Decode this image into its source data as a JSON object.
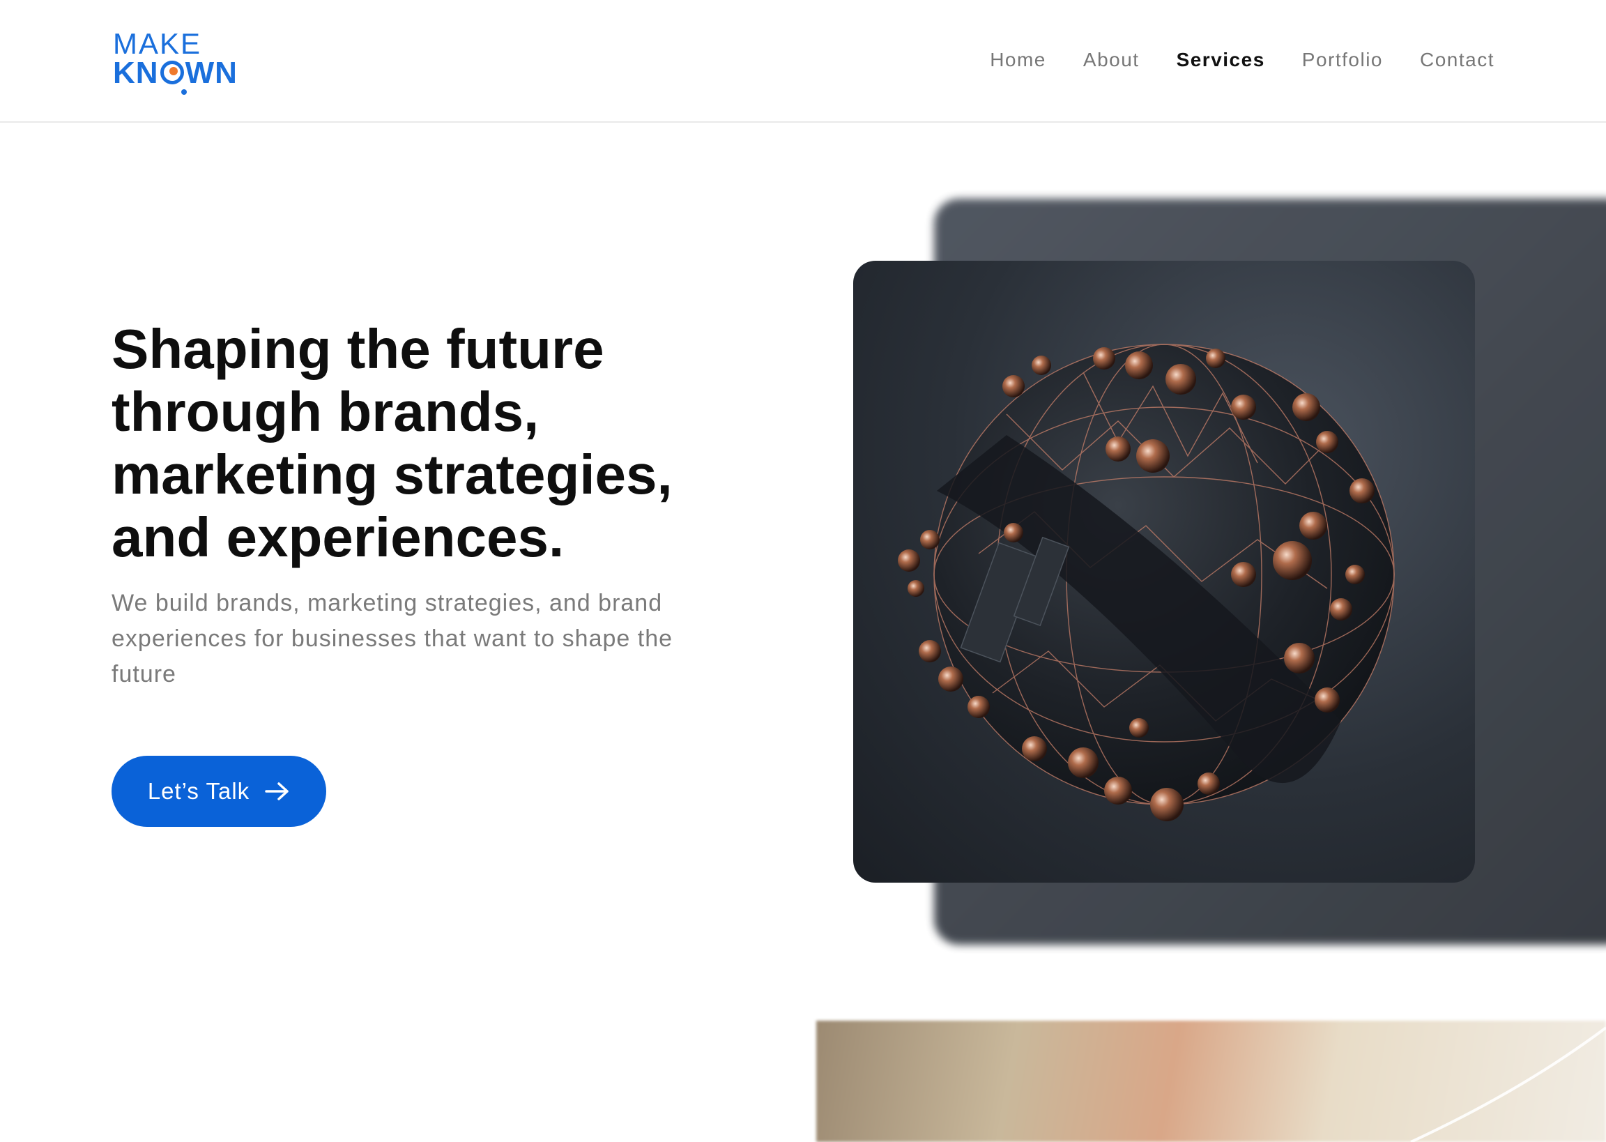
{
  "header": {
    "logo": {
      "line1": "MAKE",
      "line2_a": "KN",
      "line2_b": "WN"
    },
    "nav": [
      {
        "label": "Home",
        "active": false
      },
      {
        "label": "About",
        "active": false
      },
      {
        "label": "Services",
        "active": true
      },
      {
        "label": "Portfolio",
        "active": false
      },
      {
        "label": "Contact",
        "active": false
      }
    ]
  },
  "hero": {
    "title": "Shaping the future through brands, marketing strategies, and experiences.",
    "subtitle": "We build brands, marketing strategies, and brand experiences for businesses that want to shape the future",
    "cta_label": "Let’s Talk"
  },
  "colors": {
    "brand_blue": "#0a62d8",
    "logo_blue": "#1a6fdc",
    "logo_accent": "#ef7a2c"
  },
  "icons": {
    "cta": "arrow-right-icon"
  }
}
